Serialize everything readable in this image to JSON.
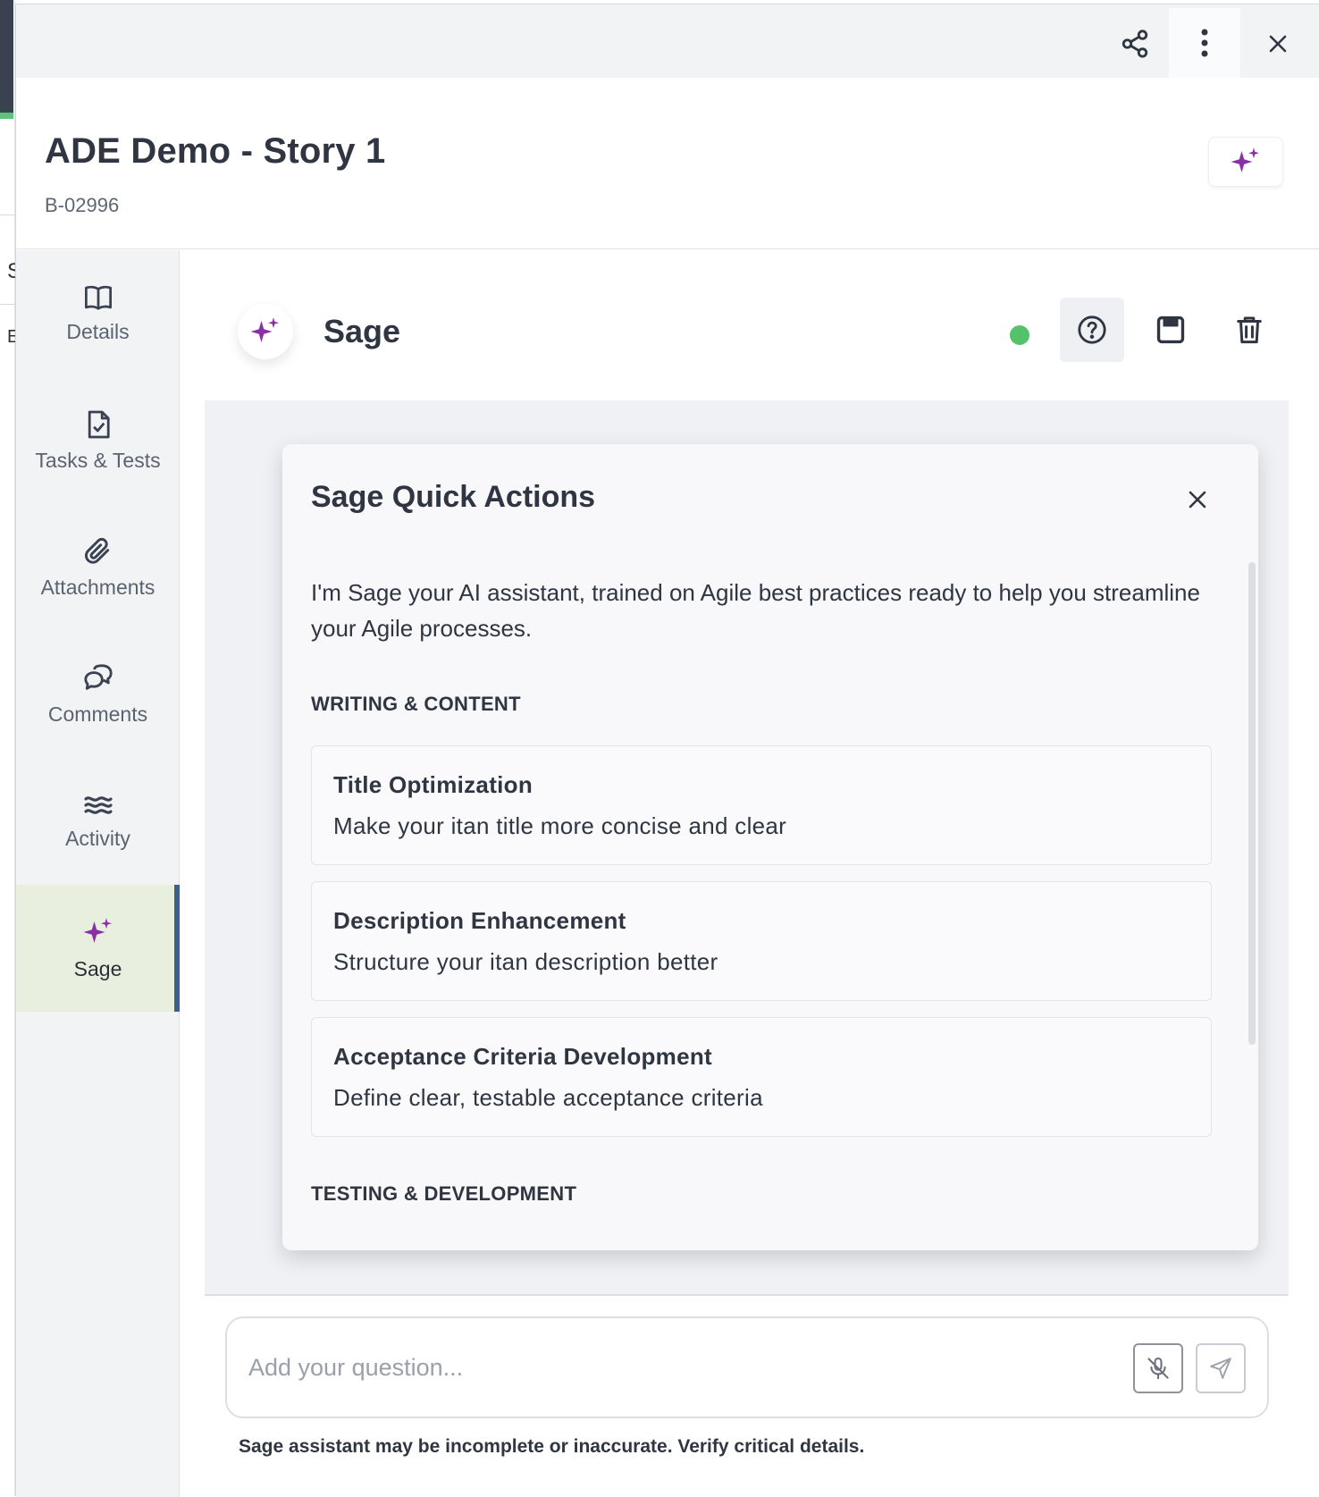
{
  "header": {
    "title": "ADE Demo - Story 1",
    "item_id": "B-02996"
  },
  "background": {
    "letters": [
      "S",
      "E"
    ]
  },
  "sidenav": {
    "items": [
      {
        "label": "Details",
        "icon": "book-icon"
      },
      {
        "label": "Tasks & Tests",
        "icon": "file-check-icon"
      },
      {
        "label": "Attachments",
        "icon": "paperclip-icon"
      },
      {
        "label": "Comments",
        "icon": "comments-icon"
      },
      {
        "label": "Activity",
        "icon": "activity-waves-icon"
      },
      {
        "label": "Sage",
        "icon": "sparkles-icon",
        "active": true
      }
    ]
  },
  "sage": {
    "title": "Sage",
    "status": "online",
    "colors": {
      "accent": "#8a2fa8",
      "status": "#54c26b",
      "active_bar": "#3e5f8a",
      "active_bg": "#e9efdf"
    }
  },
  "quick_actions": {
    "title": "Sage Quick Actions",
    "intro": "I'm Sage your AI assistant, trained on Agile best practices ready to help you streamline your Agile processes.",
    "sections": [
      {
        "heading": "WRITING & CONTENT",
        "items": [
          {
            "title": "Title Optimization",
            "description": "Make your itan title more concise and clear"
          },
          {
            "title": "Description Enhancement",
            "description": "Structure your itan description better"
          },
          {
            "title": "Acceptance Criteria Development",
            "description": "Define clear, testable acceptance criteria"
          }
        ]
      },
      {
        "heading": "TESTING & DEVELOPMENT",
        "items": []
      }
    ]
  },
  "input": {
    "placeholder": "Add your question...",
    "value": ""
  },
  "disclaimer": "Sage assistant may be incomplete or inaccurate. Verify critical details."
}
